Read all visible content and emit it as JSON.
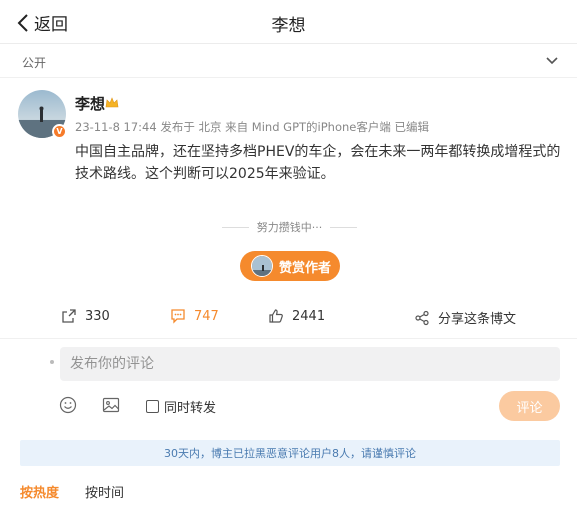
{
  "header": {
    "back_label": "返回",
    "title": "李想"
  },
  "visibility": {
    "label": "公开"
  },
  "post": {
    "author": "李想",
    "meta": "23-11-8 17:44  发布于 北京  来自 Mind GPT的iPhone客户端  已编辑",
    "text": "中国自主品牌，还在坚持多档PHEV的车企，会在未来一两年都转换成增程式的技术路线。这个判断可以2025年来验证。",
    "verified_badge": "V"
  },
  "reward": {
    "note": "努力攒钱中···",
    "button_label": "赞赏作者"
  },
  "actions": {
    "repost_count": "330",
    "comment_count": "747",
    "like_count": "2441",
    "share_label": "分享这条博文"
  },
  "composer": {
    "placeholder": "发布你的评论",
    "repost_label": "同时转发",
    "submit_label": "评论"
  },
  "notice": "30天内，博主已拉黑恶意评论用户8人，请谨慎评论",
  "sort": {
    "hot_label": "按热度",
    "time_label": "按时间"
  },
  "colors": {
    "accent": "#f58a2d",
    "notice_bg": "#e9f2fb",
    "notice_text": "#4a7bb0"
  }
}
